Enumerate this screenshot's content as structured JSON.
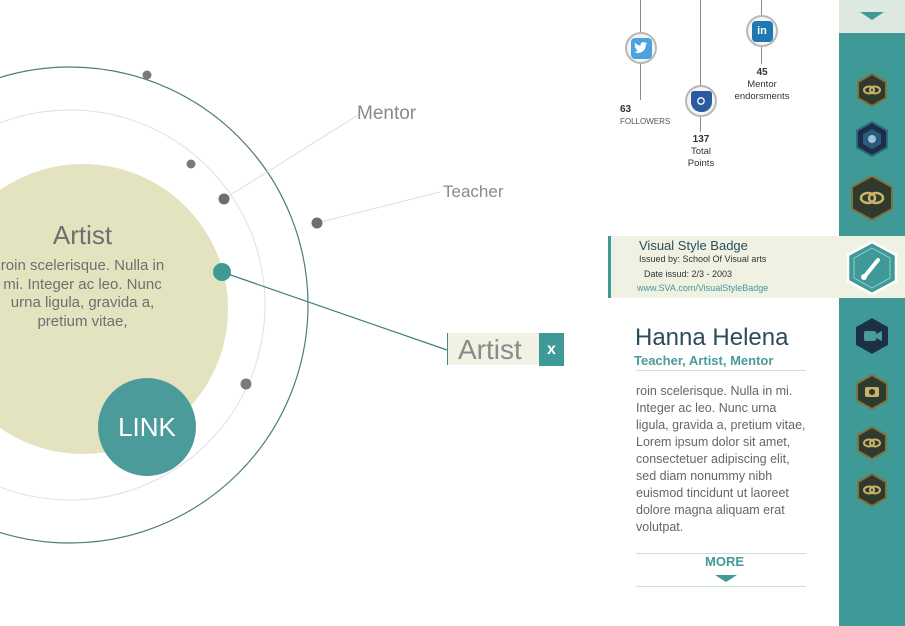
{
  "center": {
    "title": "Artist",
    "text": "roin scelerisque. Nulla in mi. Integer ac leo. Nunc urna ligula, gravida a, pretium vitae,",
    "link_label": "LINK"
  },
  "orbit_labels": {
    "mentor": "Mentor",
    "teacher": "Teacher"
  },
  "selected_tag": {
    "label": "Artist",
    "close_label": "x"
  },
  "social": {
    "twitter": {
      "icon": "twitter-bird-icon",
      "count": "63",
      "label": "FOLLOWERS"
    },
    "points": {
      "icon": "shield-badge-icon",
      "count": "137",
      "label_line1": "Total",
      "label_line2": "Points"
    },
    "linkedin": {
      "icon": "linkedin-icon",
      "count": "45",
      "label_line1": "Mentor",
      "label_line2": "endorsments"
    }
  },
  "badge": {
    "title": "Visual Style Badge",
    "issuer": "Issued by: School Of Visual arts",
    "date": "Date issud: 2/3 - 2003",
    "url": "www.SVA.com/VisualStyleBadge"
  },
  "profile": {
    "name": "Hanna Helena",
    "roles": "Teacher, Artist, Mentor",
    "bio": "roin scelerisque. Nulla in mi. Integer ac leo. Nunc urna ligula, gravida a, pretium vitae, Lorem ipsum dolor sit amet, consectetuer adipiscing elit, sed diam nonummy nibh euismod tincidunt ut laoreet dolore magna aliquam erat volutpat.",
    "more_label": "MORE"
  },
  "sidebar": {
    "badges": [
      "link-badge-icon",
      "camera-badge-icon",
      "link-badge-icon",
      "paintbrush-badge-icon",
      "video-camera-badge-icon",
      "camera-badge-icon",
      "link-badge-icon",
      "link-badge-icon"
    ]
  },
  "colors": {
    "teal": "#3f9a97",
    "navy": "#2d4b5a",
    "olive_circle": "#e3e3c0",
    "panel_bg": "#eff1e2"
  }
}
